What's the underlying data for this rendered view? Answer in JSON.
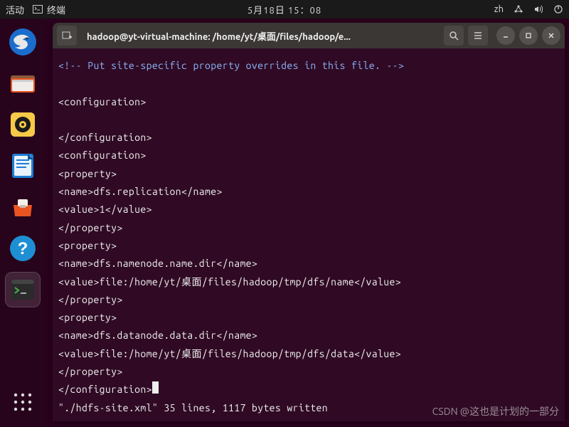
{
  "topbar": {
    "activities": "活动",
    "app_label": "终端",
    "datetime": "5月18日 15：08",
    "input_method": "zh"
  },
  "titlebar": {
    "title": "hadoop@yt-virtual-machine: /home/yt/桌面/files/hadoop/e..."
  },
  "terminal": {
    "lines": [
      "<!-- Put site-specific property overrides in this file. -->",
      "",
      "<configuration>",
      "",
      "</configuration>",
      "<configuration>",
      "<property>",
      "<name>dfs.replication</name>",
      "<value>1</value>",
      "</property>",
      "<property>",
      "<name>dfs.namenode.name.dir</name>",
      "<value>file:/home/yt/桌面/files/hadoop/tmp/dfs/name</value>",
      "</property>",
      "<property>",
      "<name>dfs.datanode.data.dir</name>",
      "<value>file:/home/yt/桌面/files/hadoop/tmp/dfs/data</value>",
      "</property>",
      "</configuration>"
    ],
    "status": "\"./hdfs-site.xml\" 35 lines, 1117 bytes written"
  },
  "watermark": "CSDN @这也是计划的一部分"
}
